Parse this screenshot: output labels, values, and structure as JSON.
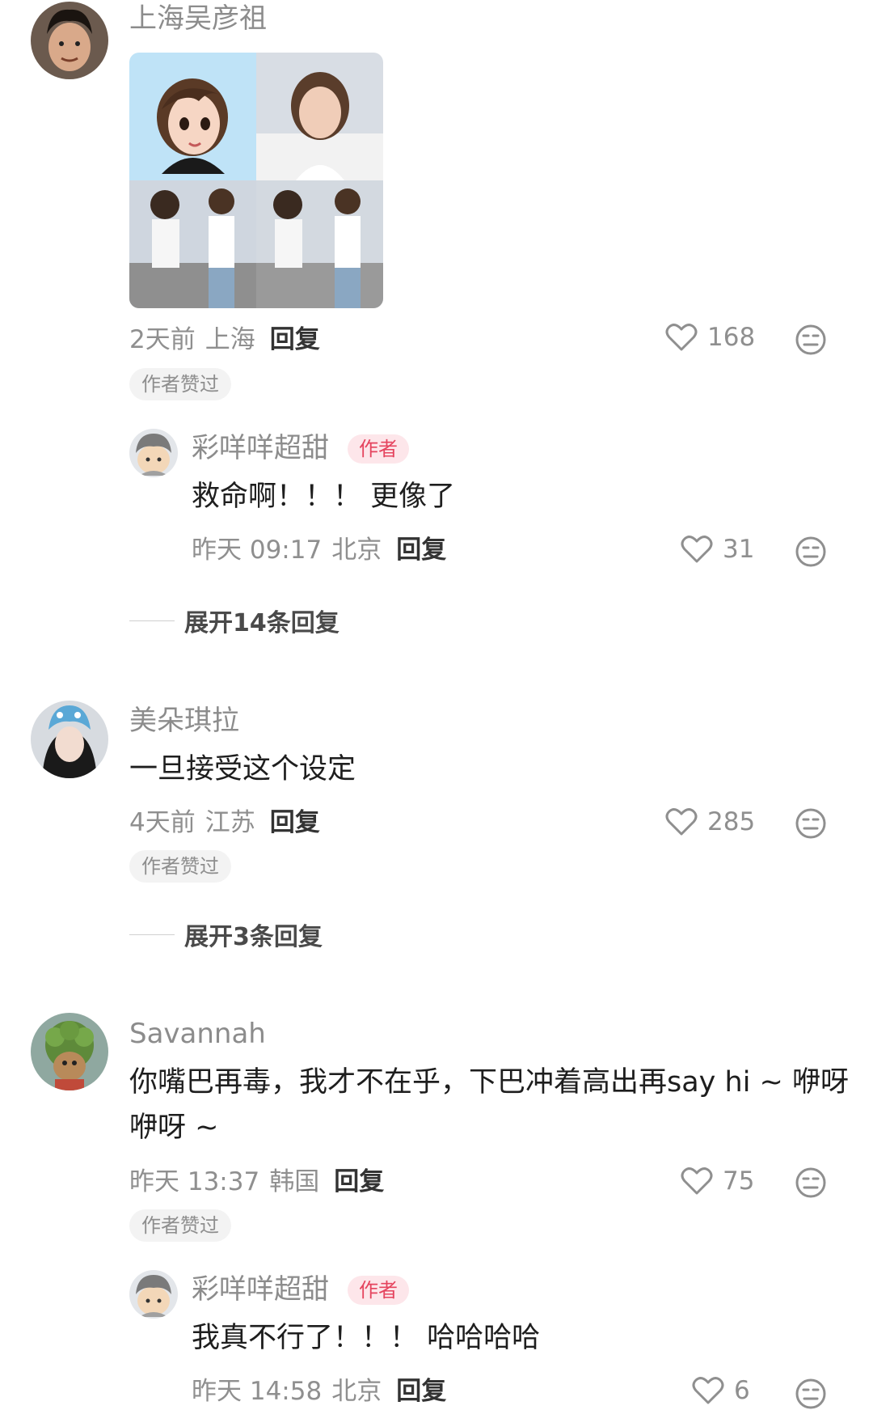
{
  "comments": [
    {
      "username": "上海吴彦祖",
      "meta_time": "2天前",
      "meta_location": "上海",
      "reply_label": "回复",
      "likes": "168",
      "badge": "作者赞过",
      "replies": [
        {
          "username": "彩咩咩超甜",
          "author_tag": "作者",
          "text": "救命啊！！！ 更像了",
          "meta_time": "昨天 09:17",
          "meta_location": "北京",
          "reply_label": "回复",
          "likes": "31"
        }
      ],
      "expand_label": "展开14条回复"
    },
    {
      "username": "美朵琪拉",
      "text": "一旦接受这个设定",
      "meta_time": "4天前",
      "meta_location": "江苏",
      "reply_label": "回复",
      "likes": "285",
      "badge": "作者赞过",
      "expand_label": "展开3条回复"
    },
    {
      "username": "Savannah",
      "text_line1": "你嘴巴再毒，我才不在乎，下巴冲着高出再say hi ~ 咿呀",
      "text_line2": "咿呀 ~",
      "meta_time": "昨天 13:37",
      "meta_location": "韩国",
      "reply_label": "回复",
      "likes": "75",
      "badge": "作者赞过",
      "replies": [
        {
          "username": "彩咩咩超甜",
          "author_tag": "作者",
          "text": "我真不行了！！！ 哈哈哈哈",
          "meta_time": "昨天 14:58",
          "meta_location": "北京",
          "reply_label": "回复",
          "likes": "6"
        }
      ]
    }
  ],
  "icons": {
    "like": "heart-outline-icon",
    "dislike": "meh-face-icon"
  },
  "colors": {
    "author_tag_bg": "#fde6ea",
    "author_tag_text": "#e5445e",
    "badge_bg": "#f3f3f3"
  }
}
